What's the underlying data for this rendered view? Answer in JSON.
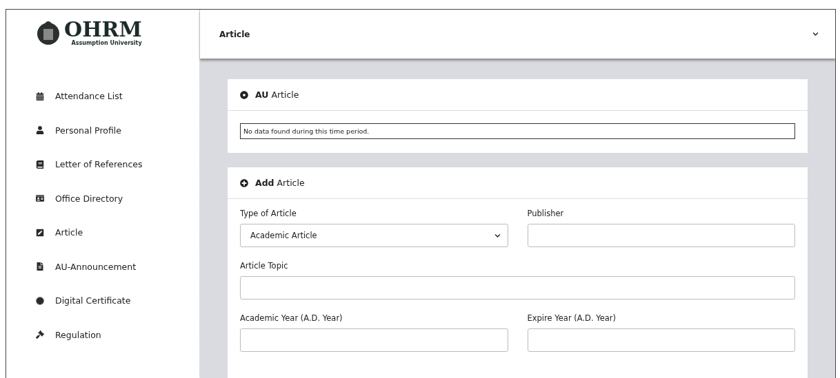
{
  "logo": {
    "title": "OHRM",
    "subtitle": "Assumption University"
  },
  "sidebar": {
    "items": [
      {
        "label": "Attendance List"
      },
      {
        "label": "Personal Profile"
      },
      {
        "label": "Letter of References"
      },
      {
        "label": "Office Directory"
      },
      {
        "label": "Article"
      },
      {
        "label": "AU-Announcement"
      },
      {
        "label": "Digital Certificate"
      },
      {
        "label": "Regulation"
      }
    ]
  },
  "header": {
    "title": "Article"
  },
  "list_card": {
    "title": "**AU** Article",
    "message": "No data found during this time period."
  },
  "form_card": {
    "title": "**Add** Article",
    "rows": [
      [
        {
          "label": "Type of Article",
          "kind": "select",
          "value": "Academic Article"
        },
        {
          "label": "Publisher",
          "kind": "text"
        }
      ],
      [
        {
          "label": "Article Topic",
          "kind": "text"
        }
      ],
      [
        {
          "label": "Academic Year (A.D. Year)",
          "kind": "text"
        },
        {
          "label": "Expire Year (A.D. Year)",
          "kind": "text"
        }
      ]
    ]
  }
}
